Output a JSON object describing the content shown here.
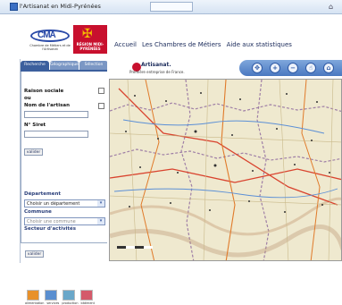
{
  "window": {
    "title": "l'Artisanat en Midi-Pyrénées"
  },
  "header": {
    "cma_logo_text": "CMA",
    "cma_logo_sub": "Chambre de Métiers et de l'Artisanat",
    "region_logo": "RÉGION MIDI-PYRÉNÉES",
    "nav": [
      "Accueil",
      "Les Chambres de Métiers",
      "Aide aux statistiques"
    ]
  },
  "sidebar": {
    "tabs": [
      "Recherche",
      "Géographique",
      "Sélection"
    ],
    "raison_sociale": "Raison sociale",
    "ou": "ou",
    "nom_artisan": "Nom de l'artisan",
    "siret": "N° Siret",
    "valider1": "valider",
    "departement_label": "Département",
    "departement_value": "Choisir un département",
    "commune_label": "Commune",
    "commune_value": "Choisir une commune",
    "secteur_label": "Secteur d'activités",
    "secteurs": [
      "alimentation",
      "services",
      "production",
      "bâtiment"
    ],
    "valider2": "valider"
  },
  "map": {
    "brand": "Artisanat.",
    "tagline": "Première entreprise de France.",
    "controls": [
      "✥",
      "+",
      "−",
      "☝",
      "⌂"
    ]
  }
}
